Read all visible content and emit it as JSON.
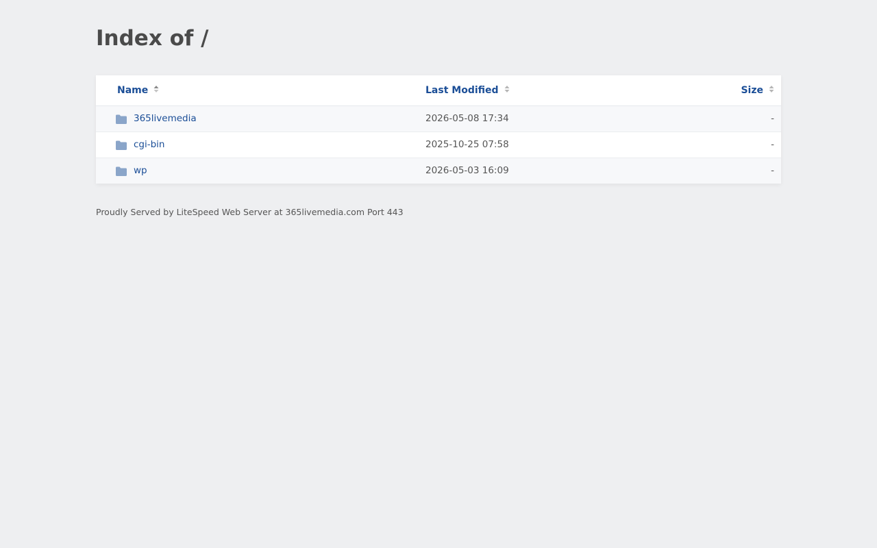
{
  "page": {
    "title": "Index of /"
  },
  "table": {
    "headers": {
      "name": "Name",
      "last_modified": "Last Modified",
      "size": "Size"
    },
    "rows": [
      {
        "name": "365livemedia",
        "last_modified": "2026-05-08 17:34",
        "size": "-",
        "icon": "folder-icon"
      },
      {
        "name": "cgi-bin",
        "last_modified": "2025-10-25 07:58",
        "size": "-",
        "icon": "folder-icon"
      },
      {
        "name": "wp",
        "last_modified": "2026-05-03 16:09",
        "size": "-",
        "icon": "folder-icon"
      }
    ]
  },
  "footer": {
    "text": "Proudly Served by LiteSpeed Web Server at 365livemedia.com Port 443"
  },
  "colors": {
    "background": "#eeeff1",
    "link": "#1b4e97",
    "folder_icon": "#8aa5c9",
    "sort_icon": "#9a9a9a"
  }
}
